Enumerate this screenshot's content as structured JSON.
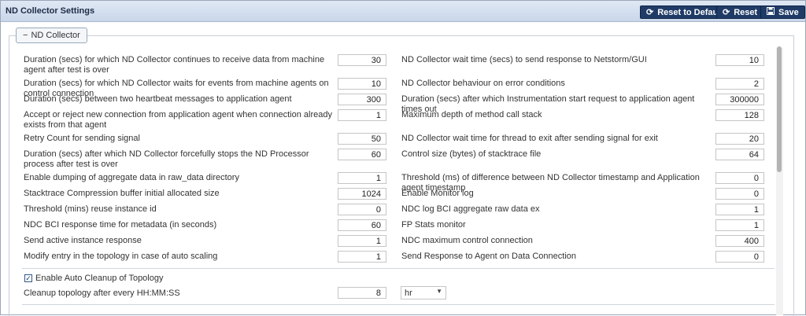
{
  "header": {
    "title": "ND Collector Settings",
    "buttons": [
      {
        "label": "Reset to Default",
        "icon": "refresh-icon"
      },
      {
        "label": "Reset",
        "icon": "refresh-icon"
      },
      {
        "label": "Save",
        "icon": "floppy-disk-icon"
      }
    ]
  },
  "section": {
    "legend": "ND Collector",
    "collapse_icon": "−"
  },
  "left_settings": [
    {
      "label": "Duration (secs) for which ND Collector continues to receive data from machine agent after test is over",
      "value": "30"
    },
    {
      "label": "Duration (secs) for which ND Collector waits for events from machine agents on control connection",
      "value": "10"
    },
    {
      "label": "Duration (secs) between two heartbeat messages to application agent",
      "value": "300"
    },
    {
      "label": "Accept or reject new connection from application agent when connection already exists from that agent",
      "value": "1"
    },
    {
      "label": "Retry Count for sending signal",
      "value": "50"
    },
    {
      "label": "Duration (secs) after which ND Collector forcefully stops the ND Processor process after test is over",
      "value": "60"
    },
    {
      "label": "Enable dumping of aggregate data in raw_data directory",
      "value": "1"
    },
    {
      "label": "Stacktrace Compression buffer initial allocated size",
      "value": "1024"
    },
    {
      "label": "Threshold (mins) reuse instance id",
      "value": "0"
    },
    {
      "label": "NDC BCI response time for metadata (in seconds)",
      "value": "60"
    },
    {
      "label": "Send active instance response",
      "value": "1"
    },
    {
      "label": "Modify entry in the topology in case of auto scaling",
      "value": "1"
    }
  ],
  "right_settings": [
    {
      "label": "ND Collector wait time (secs) to send response to Netstorm/GUI",
      "value": "10"
    },
    {
      "label": "ND Collector behaviour on error conditions",
      "value": "2"
    },
    {
      "label": "Duration (secs) after which Instrumentation start request to application agent times out",
      "value": "300000"
    },
    {
      "label": "Maximum depth of method call stack",
      "value": "128"
    },
    {
      "label": "ND Collector wait time for thread to exit after sending signal for exit",
      "value": "20"
    },
    {
      "label": "Control size (bytes) of stacktrace file",
      "value": "64"
    },
    {
      "label": "Threshold (ms) of difference between ND Collector timestamp and Application agent timestamp",
      "value": "0"
    },
    {
      "label": "Enable Monitor log",
      "value": "0"
    },
    {
      "label": "NDC log BCI aggregate raw data ex",
      "value": "1"
    },
    {
      "label": "FP Stats monitor",
      "value": "1"
    },
    {
      "label": "NDC maximum control connection",
      "value": "400"
    },
    {
      "label": "Send Response to Agent on Data Connection",
      "value": "0"
    }
  ],
  "auto_cleanup": {
    "checkbox_label": "Enable Auto Cleanup of Topology",
    "checked": true,
    "check_glyph": "✓",
    "interval_label": "Cleanup topology after every HH:MM:SS",
    "interval_value": "8",
    "unit_selected": "hr",
    "unit_arrow": "▼"
  },
  "colors": {
    "button_bg": "#1f3b66",
    "titlebar_bg": "#c9d7ea"
  }
}
